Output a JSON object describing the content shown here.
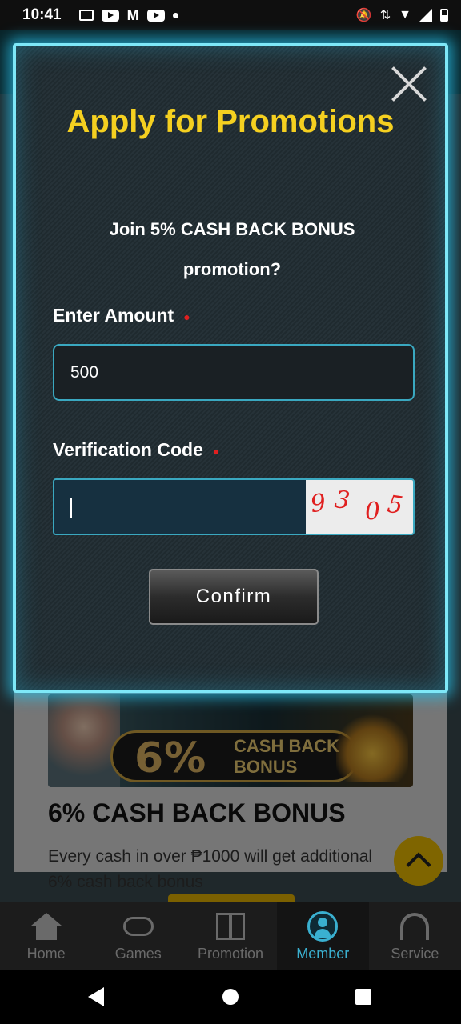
{
  "status_bar": {
    "time": "10:41"
  },
  "background": {
    "banner": {
      "percent": "6%",
      "line1": "CASH BACK",
      "line2": "BONUS"
    },
    "promo_title": "6% CASH BACK BONUS",
    "promo_description": "Every cash in over ₱1000 will get additional 6% cash back bonus"
  },
  "modal": {
    "title": "Apply for Promotions",
    "question": "Join 5% CASH BACK BONUS promotion?",
    "amount_label": "Enter Amount",
    "amount_value": "500",
    "required_mark": "●",
    "verification_label": "Verification Code",
    "verification_value": "",
    "captcha": [
      "9",
      "3",
      "0",
      "5"
    ],
    "confirm_label": "Confirm"
  },
  "tabbar": {
    "items": [
      {
        "label": "Home",
        "icon": "home-icon"
      },
      {
        "label": "Games",
        "icon": "gamepad-icon"
      },
      {
        "label": "Promotion",
        "icon": "gift-icon"
      },
      {
        "label": "Member",
        "icon": "member-icon",
        "active": true
      },
      {
        "label": "Service",
        "icon": "headset-icon"
      }
    ]
  },
  "colors": {
    "accent_cyan": "#3ab0d0",
    "title_yellow": "#f5d020",
    "modal_glow": "#7ee8f8",
    "required_red": "#e02020"
  }
}
